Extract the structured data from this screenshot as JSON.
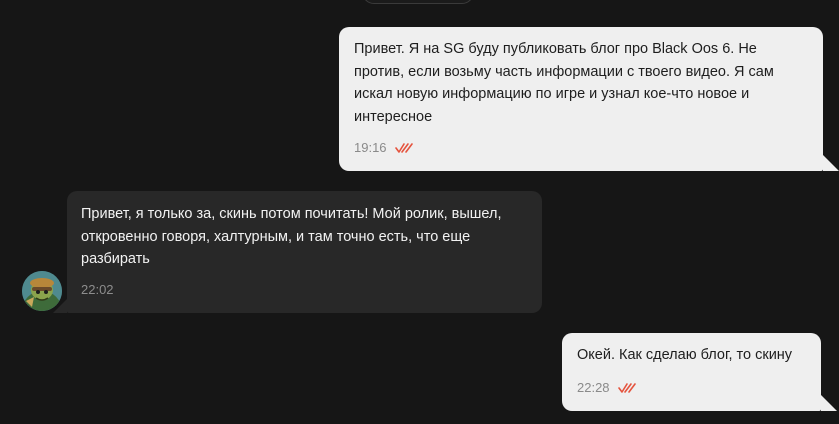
{
  "messages": [
    {
      "direction": "outgoing",
      "text": "Привет. Я на SG буду публиковать блог про Black Oos 6. Не против, если возьму часть информации с твоего видео. Я сам искал новую информацию по игре и узнал кое-что новое и интересное",
      "time": "19:16",
      "status_icon": "read-checkmarks-icon"
    },
    {
      "direction": "incoming",
      "text": "Привет, я только за, скинь потом почитать! Мой ролик, вышел, откровенно говоря, халтурным, и там точно есть, что еще разбирать",
      "time": "22:02",
      "avatar_icon": "avatar"
    },
    {
      "direction": "outgoing",
      "text": "Окей. Как сделаю блог, то скину",
      "time": "22:28",
      "status_icon": "read-checkmarks-icon"
    }
  ],
  "colors": {
    "background": "#161616",
    "outgoing_bubble": "#efefef",
    "incoming_bubble": "#282828",
    "read_check": "#e5533d"
  }
}
